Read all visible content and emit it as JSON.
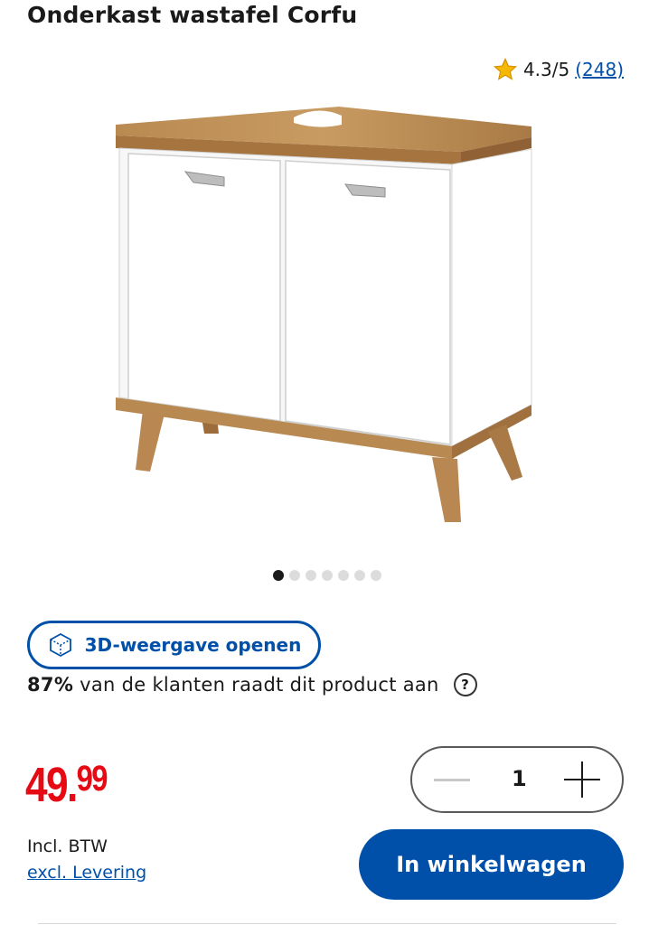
{
  "product": {
    "title": "Onderkast wastafel Corfu",
    "image_icon": "bathroom-vanity-cabinet-image"
  },
  "rating": {
    "score": "4.3/5",
    "count": "(248)",
    "icon": "star-icon"
  },
  "gallery": {
    "dot_count": 7,
    "active_index": 0
  },
  "view_3d": {
    "label": "3D-weergave openen",
    "icon": "cube-3d-icon"
  },
  "recommendation": {
    "percent": "87%",
    "text": "van de klanten raadt dit product aan",
    "help_symbol": "?"
  },
  "price": {
    "integer": "49.",
    "decimals": "99",
    "incl_label": "Incl. BTW",
    "excl_link": "excl. Levering"
  },
  "quantity": {
    "value": "1"
  },
  "cart": {
    "button_label": "In winkelwagen"
  },
  "colors": {
    "brand_blue": "#0050aa",
    "price_red": "#e60a14",
    "star_yellow": "#f5b800"
  }
}
